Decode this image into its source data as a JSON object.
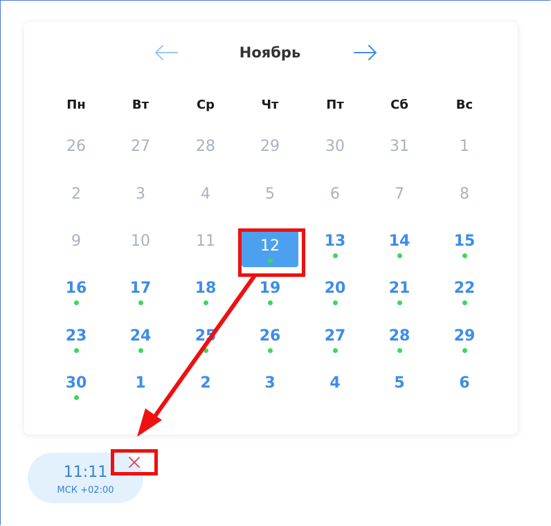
{
  "calendar": {
    "month": "Ноябрь",
    "weekdays": [
      "Пн",
      "Вт",
      "Ср",
      "Чт",
      "Пт",
      "Сб",
      "Вс"
    ],
    "weeks": [
      [
        {
          "d": "26",
          "s": "muted"
        },
        {
          "d": "27",
          "s": "muted"
        },
        {
          "d": "28",
          "s": "muted"
        },
        {
          "d": "29",
          "s": "muted"
        },
        {
          "d": "30",
          "s": "muted"
        },
        {
          "d": "31",
          "s": "muted"
        },
        {
          "d": "1",
          "s": "muted"
        }
      ],
      [
        {
          "d": "2",
          "s": "muted"
        },
        {
          "d": "3",
          "s": "muted"
        },
        {
          "d": "4",
          "s": "muted"
        },
        {
          "d": "5",
          "s": "muted"
        },
        {
          "d": "6",
          "s": "muted"
        },
        {
          "d": "7",
          "s": "muted"
        },
        {
          "d": "8",
          "s": "muted"
        }
      ],
      [
        {
          "d": "9",
          "s": "muted"
        },
        {
          "d": "10",
          "s": "muted"
        },
        {
          "d": "11",
          "s": "muted"
        },
        {
          "d": "12",
          "s": "selected",
          "dot": true
        },
        {
          "d": "13",
          "s": "active",
          "dot": true
        },
        {
          "d": "14",
          "s": "active",
          "dot": true
        },
        {
          "d": "15",
          "s": "active",
          "dot": true
        }
      ],
      [
        {
          "d": "16",
          "s": "active",
          "dot": true
        },
        {
          "d": "17",
          "s": "active",
          "dot": true
        },
        {
          "d": "18",
          "s": "active",
          "dot": true
        },
        {
          "d": "19",
          "s": "active",
          "dot": true
        },
        {
          "d": "20",
          "s": "active",
          "dot": true
        },
        {
          "d": "21",
          "s": "active",
          "dot": true
        },
        {
          "d": "22",
          "s": "active",
          "dot": true
        }
      ],
      [
        {
          "d": "23",
          "s": "active",
          "dot": true
        },
        {
          "d": "24",
          "s": "active",
          "dot": true
        },
        {
          "d": "25",
          "s": "active",
          "dot": true
        },
        {
          "d": "26",
          "s": "active",
          "dot": true
        },
        {
          "d": "27",
          "s": "active",
          "dot": true
        },
        {
          "d": "28",
          "s": "active",
          "dot": true
        },
        {
          "d": "29",
          "s": "active",
          "dot": true
        }
      ],
      [
        {
          "d": "30",
          "s": "active",
          "dot": true
        },
        {
          "d": "1",
          "s": "active"
        },
        {
          "d": "2",
          "s": "active"
        },
        {
          "d": "3",
          "s": "active"
        },
        {
          "d": "4",
          "s": "active"
        },
        {
          "d": "5",
          "s": "active"
        },
        {
          "d": "6",
          "s": "active"
        }
      ]
    ],
    "prev_icon": "arrow-left-icon",
    "next_icon": "arrow-right-icon"
  },
  "time_slot": {
    "time": "11:11",
    "timezone": "МСК +02:00",
    "remove_icon": "close-icon"
  },
  "colors": {
    "accent": "#3d8de8",
    "selected_bg": "#4da0ef",
    "available_dot": "#3bd85a",
    "muted_text": "#a9b2bd",
    "annotation_red": "#ef1010",
    "pill_bg": "#e3f1fc"
  }
}
